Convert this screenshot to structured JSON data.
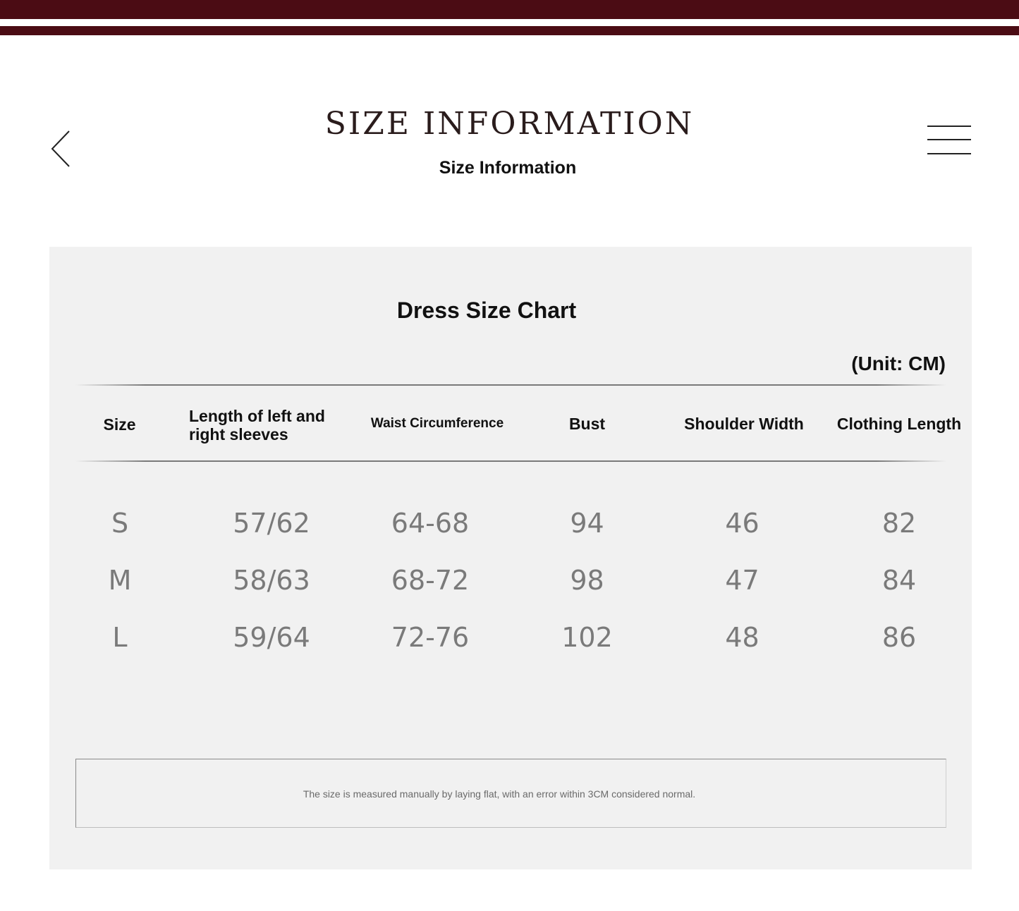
{
  "header": {
    "title": "SIZE INFORMATION",
    "subtitle": "Size Information",
    "accent_color": "#4b0c14",
    "back_icon": "chevron-left-icon",
    "menu_icon": "hamburger-menu-icon"
  },
  "chart": {
    "title": "Dress Size Chart",
    "unit": "(Unit: CM)",
    "columns": [
      "Size",
      "Length of left and right sleeves",
      "Waist Circumference",
      "Bust",
      "Shoulder Width",
      "Clothing Length"
    ],
    "rows": [
      [
        "S",
        "57/62",
        "64-68",
        "94",
        "46",
        "82"
      ],
      [
        "M",
        "58/63",
        "68-72",
        "98",
        "47",
        "84"
      ],
      [
        "L",
        "59/64",
        "72-76",
        "102",
        "48",
        "86"
      ]
    ],
    "note": "The size is measured manually by laying flat, with an error within 3CM considered normal."
  }
}
